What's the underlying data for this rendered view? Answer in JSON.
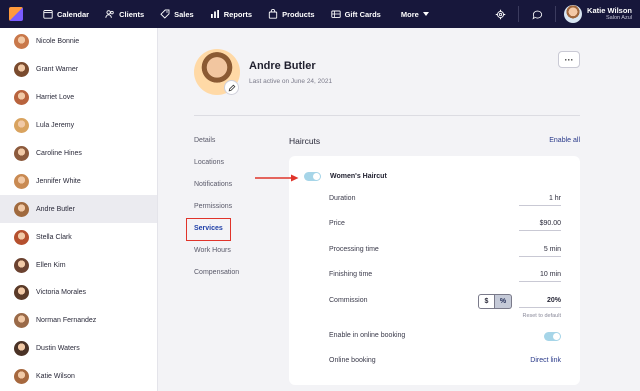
{
  "nav": {
    "items": [
      {
        "label": "Calendar",
        "icon": "calendar-icon"
      },
      {
        "label": "Clients",
        "icon": "clients-icon"
      },
      {
        "label": "Sales",
        "icon": "sales-tag-icon"
      },
      {
        "label": "Reports",
        "icon": "reports-chart-icon"
      },
      {
        "label": "Products",
        "icon": "products-bag-icon"
      },
      {
        "label": "Gift Cards",
        "icon": "gift-card-icon"
      }
    ],
    "more_label": "More",
    "user_name": "Katie Wilson",
    "user_salon": "Salon Azul"
  },
  "clients": [
    {
      "name": "Nicole Bonnie",
      "color": "#c9784a"
    },
    {
      "name": "Grant Warner",
      "color": "#7a4b2e"
    },
    {
      "name": "Harriet Love",
      "color": "#b8633d"
    },
    {
      "name": "Lula Jeremy",
      "color": "#d9a35f"
    },
    {
      "name": "Caroline Hines",
      "color": "#8c5a3c"
    },
    {
      "name": "Jennifer White",
      "color": "#c98a52"
    },
    {
      "name": "Andre Butler",
      "color": "#a06a3e"
    },
    {
      "name": "Stella Clark",
      "color": "#b5502e"
    },
    {
      "name": "Ellen Kim",
      "color": "#6b4230"
    },
    {
      "name": "Victoria Morales",
      "color": "#5a3a28"
    },
    {
      "name": "Norman Fernandez",
      "color": "#9a6a48"
    },
    {
      "name": "Dustin Waters",
      "color": "#4a3226"
    },
    {
      "name": "Katie Wilson",
      "color": "#a6683e"
    }
  ],
  "active_client": "Andre Butler",
  "profile": {
    "name": "Andre Butler",
    "last_active": "Last active on June 24, 2021",
    "more_label": "···"
  },
  "sidenav": [
    "Details",
    "Locations",
    "Notifications",
    "Permissions",
    "Services",
    "Work Hours",
    "Compensation"
  ],
  "section": {
    "title": "Haircuts",
    "enable_all": "Enable all"
  },
  "service": {
    "name": "Women's Haircut",
    "enabled": true,
    "rows": [
      {
        "label": "Duration",
        "value": "1 hr"
      },
      {
        "label": "Price",
        "value": "$90.00"
      },
      {
        "label": "Processing time",
        "value": "5 min"
      },
      {
        "label": "Finishing time",
        "value": "10 min"
      }
    ],
    "commission": {
      "label": "Commission",
      "dollar": "$",
      "percent": "%",
      "selected": "%",
      "value": "20%",
      "reset": "Reset to default"
    },
    "online_booking_label": "Enable in online booking",
    "online_booking_enabled": true,
    "online_link_label": "Online booking",
    "online_link_value": "Direct link"
  },
  "colors": {
    "topbar": "#17173b",
    "accent": "#2a3a8a",
    "toggle_on": "#a6d5e8",
    "annotation": "#e0342a"
  }
}
